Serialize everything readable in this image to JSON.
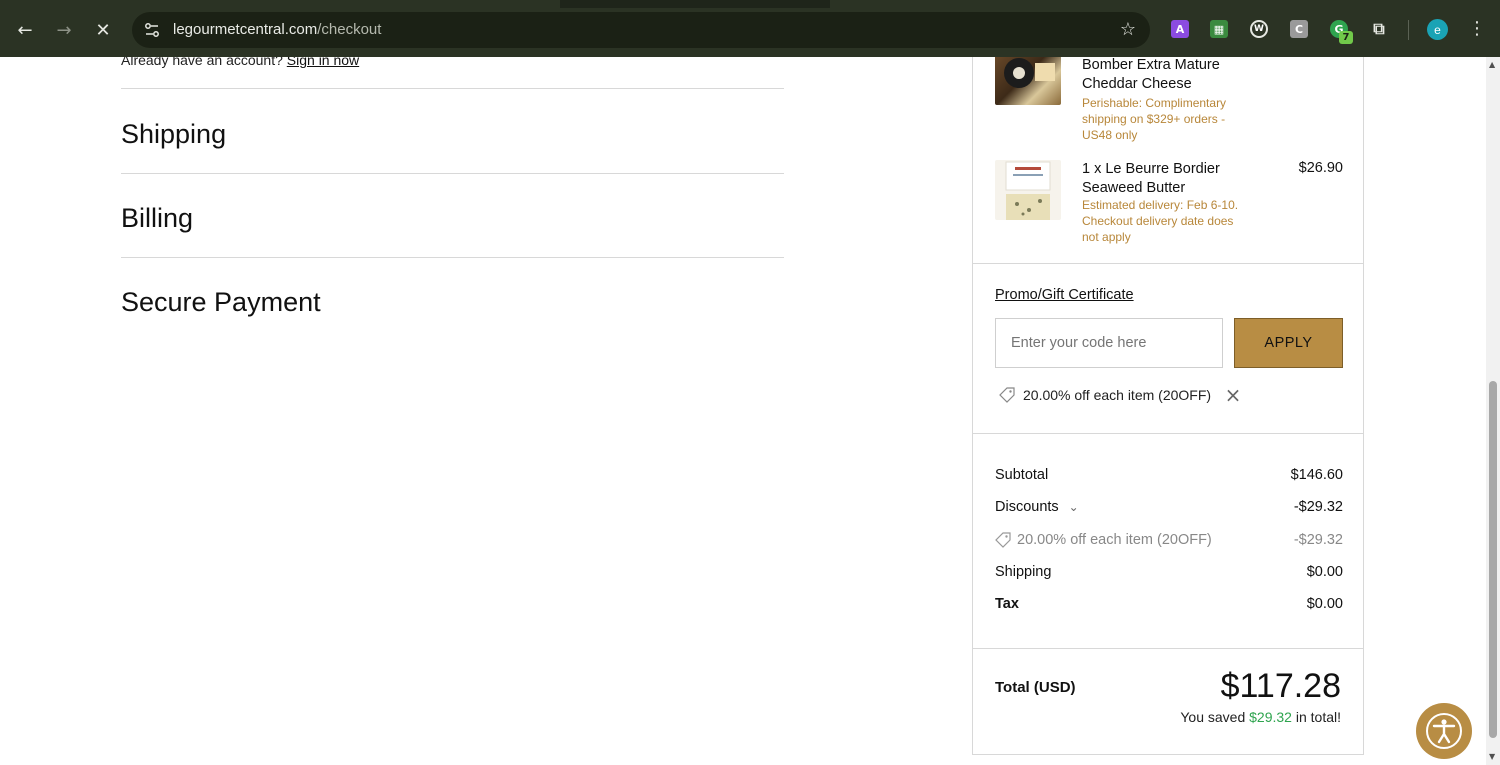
{
  "browser": {
    "url_host": "legourmetcentral.com",
    "url_path": "/checkout",
    "profile_initial": "e",
    "extension_badge": "7"
  },
  "checkout": {
    "signin_prompt": "Already have an account?",
    "signin_link": "Sign in now",
    "sections": [
      "Shipping",
      "Billing",
      "Secure Payment"
    ]
  },
  "summary": {
    "items": [
      {
        "name": "Bomber Extra Mature Cheddar Cheese",
        "note": "Perishable: Complimentary shipping on $329+ orders - US48 only",
        "price": ""
      },
      {
        "name": "1 x Le Beurre Bordier Seaweed Butter",
        "note": "Estimated delivery: Feb 6-10. Checkout delivery date does not apply",
        "price": "$26.90"
      }
    ],
    "promo": {
      "label": "Promo/Gift Certificate",
      "placeholder": "Enter your code here",
      "apply_label": "APPLY",
      "applied_code": "20.00% off each item (20OFF)"
    },
    "totals": {
      "subtotal_label": "Subtotal",
      "subtotal_value": "$146.60",
      "discounts_label": "Discounts",
      "discounts_value": "-$29.32",
      "discount_detail_label": "20.00% off each item (20OFF)",
      "discount_detail_value": "-$29.32",
      "shipping_label": "Shipping",
      "shipping_value": "$0.00",
      "tax_label": "Tax",
      "tax_value": "$0.00",
      "total_label": "Total (USD)",
      "total_value": "$117.28",
      "saved_prefix": "You saved",
      "saved_amount": "$29.32",
      "saved_suffix": "in total!"
    }
  },
  "colors": {
    "accent_gold": "#b88d44",
    "note_text": "#b8873a",
    "saved_green": "#2fa44f",
    "chrome_bg": "#2b3324"
  }
}
